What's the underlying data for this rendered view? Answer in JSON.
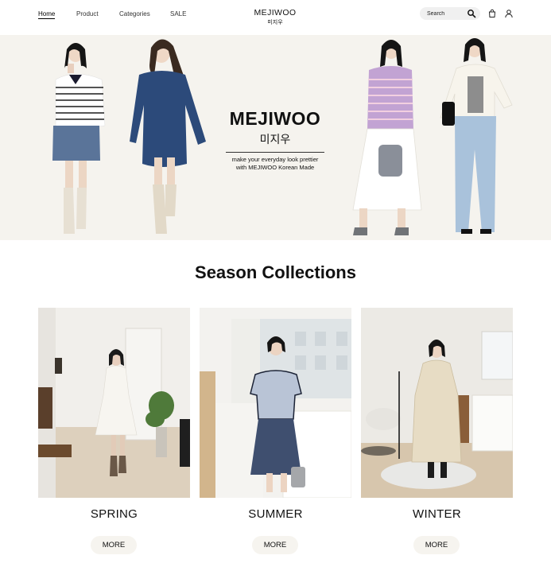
{
  "header": {
    "nav": [
      {
        "label": "Home",
        "active": true
      },
      {
        "label": "Product",
        "active": false
      },
      {
        "label": "Categories",
        "active": false
      },
      {
        "label": "SALE",
        "active": false
      }
    ],
    "logo": {
      "en": "MEJIWOO",
      "ko": "미지우"
    },
    "search": {
      "placeholder": "Search"
    },
    "icons": [
      "search-icon",
      "shopping-bag-icon",
      "user-icon"
    ]
  },
  "hero": {
    "brand": "MEJIWOO",
    "brand_ko": "미지우",
    "tagline_1": "make your everyday look prettier",
    "tagline_2": "with MEJIWOO Korean Made"
  },
  "season": {
    "title": "Season Collections",
    "cards": [
      {
        "label": "SPRING",
        "button": "MORE"
      },
      {
        "label": "SUMMER",
        "button": "MORE"
      },
      {
        "label": "WINTER",
        "button": "MORE"
      }
    ]
  },
  "colors": {
    "hero_bg": "#f5f3ee",
    "button_bg": "#f6f4ef",
    "text": "#111111"
  }
}
